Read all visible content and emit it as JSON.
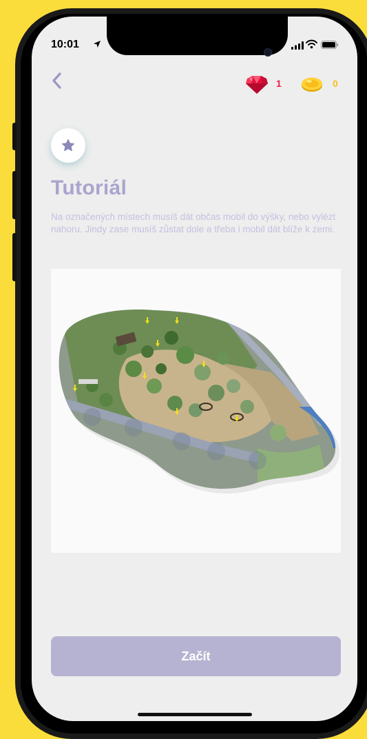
{
  "status": {
    "time": "10:01"
  },
  "header": {
    "gems": "1",
    "coins": "0"
  },
  "tutorial": {
    "title": "Tutoriál",
    "description": "Na označených místech musíš dát občas mobil do výšky, nebo vylézt nahoru. Jindy zase musíš zůstat dole a třeba i mobil dát blíže k zemi."
  },
  "actions": {
    "start_label": "Začít"
  },
  "colors": {
    "background": "#FADD3A",
    "title": "#A9A4CE",
    "button": "#B6B3D2",
    "gem": "#F01E46",
    "coin": "#F5C316"
  },
  "icons": [
    "location-arrow-icon",
    "signal-icon",
    "wifi-icon",
    "battery-icon",
    "back-chevron-icon",
    "gem-icon",
    "coin-icon",
    "star-icon",
    "park-map-illustration"
  ]
}
